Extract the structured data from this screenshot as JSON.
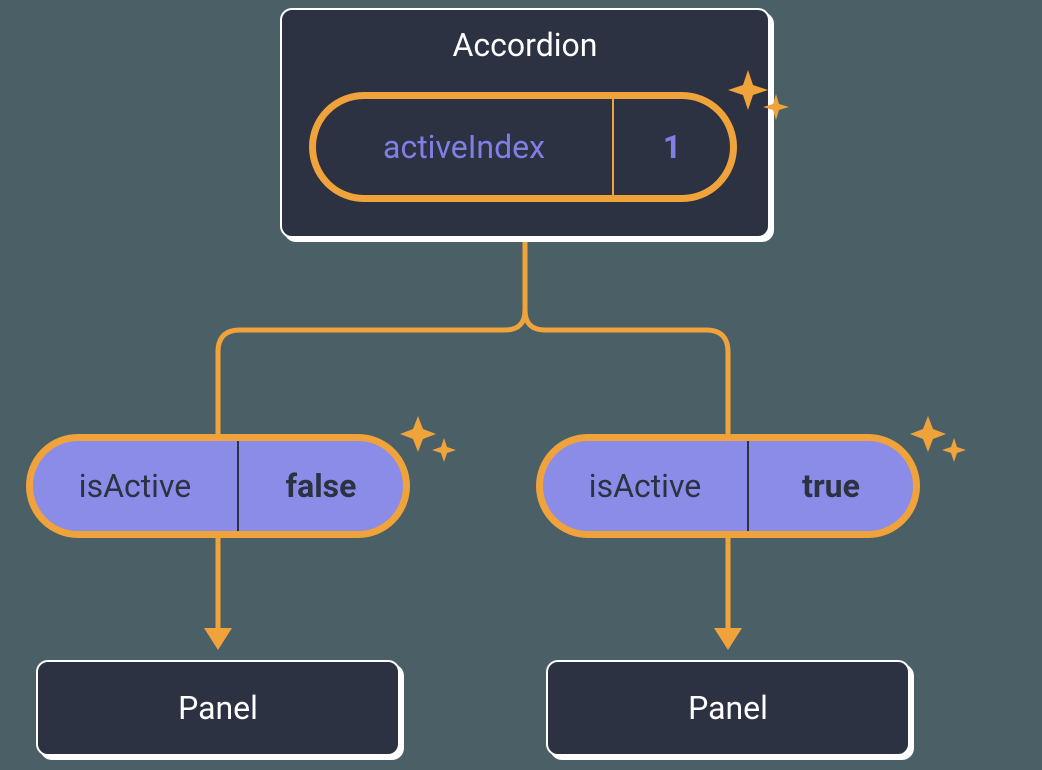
{
  "colors": {
    "bg": "#4a6066",
    "card_bg": "#2c3241",
    "card_border": "#ffffff",
    "accent_orange": "#f0a33a",
    "state_blue_text": "#7f7fe6",
    "prop_purple_bg": "#8a8ce8",
    "dark_text": "#2c3241",
    "sparkle": "#f0a33a"
  },
  "accordion": {
    "title": "Accordion",
    "state": {
      "label": "activeIndex",
      "value": "1"
    }
  },
  "children": {
    "left": {
      "prop_label": "isActive",
      "prop_value": "false",
      "panel_label": "Panel"
    },
    "right": {
      "prop_label": "isActive",
      "prop_value": "true",
      "panel_label": "Panel"
    }
  }
}
